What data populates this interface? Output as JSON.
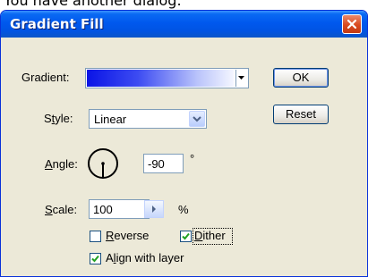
{
  "caption": "You have another dialog.",
  "dialog": {
    "title": "Gradient Fill",
    "close_glyph": "✕"
  },
  "gradient": {
    "label": "Gradient:",
    "colors": [
      "#0a14e6",
      "#3d4cf2",
      "#b9c3fb",
      "#f4f6ff"
    ]
  },
  "style": {
    "label_first": "S",
    "label_mnemonic": "t",
    "label_rest": "yle:",
    "value": "Linear"
  },
  "angle": {
    "label_mnemonic": "A",
    "label_rest": "ngle:",
    "value": "-90",
    "unit": "°"
  },
  "scale": {
    "label_mnemonic": "S",
    "label_rest": "cale:",
    "value": "100",
    "unit": "%"
  },
  "reverse": {
    "label_mnemonic": "R",
    "label_rest": "everse",
    "checked": false
  },
  "dither": {
    "label_mnemonic": "D",
    "label_rest": "ither",
    "checked": true
  },
  "align": {
    "label_first": "A",
    "label_mnemonic": "l",
    "label_rest": "ign with layer",
    "checked": true
  },
  "buttons": {
    "ok": "OK",
    "reset": "Reset"
  }
}
